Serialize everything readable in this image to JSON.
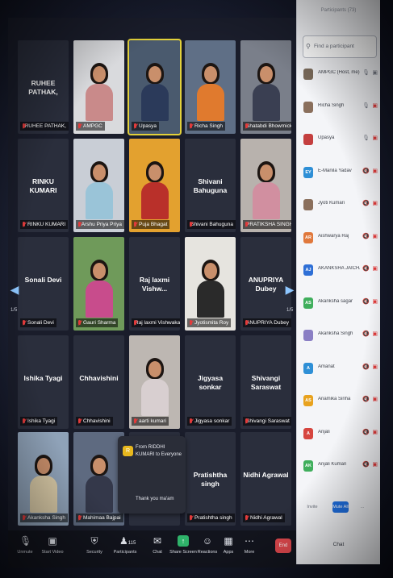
{
  "panel": {
    "title": "Participants (73)",
    "search_placeholder": "Find a participant",
    "participants": [
      {
        "name": "AMPGC (Host, me)",
        "initials": "",
        "color": "#7a6a5a",
        "mic": "on",
        "video": "on"
      },
      {
        "name": "Richa Singh",
        "initials": "",
        "color": "#8a6f5c",
        "mic": "on",
        "video": "off"
      },
      {
        "name": "Upasya",
        "initials": "",
        "color": "#c43f3f",
        "mic": "on",
        "video": "off"
      },
      {
        "name": "E-Manila Yadav",
        "initials": "EY",
        "color": "#2e8fd6",
        "mic": "off",
        "video": "off"
      },
      {
        "name": "Jyoti Kumari",
        "initials": "",
        "color": "#8a6f5c",
        "mic": "off",
        "video": "off"
      },
      {
        "name": "Aishwarya Raj",
        "initials": "AR",
        "color": "#e0783c",
        "mic": "off",
        "video": "off"
      },
      {
        "name": "AKANKSHA JAICHAND",
        "initials": "AJ",
        "color": "#2e6fd6",
        "mic": "off",
        "video": "off"
      },
      {
        "name": "Akanksha sagar",
        "initials": "AS",
        "color": "#3fae5c",
        "mic": "off",
        "video": "off"
      },
      {
        "name": "Akanksha Singh",
        "initials": "",
        "color": "#8a7fc4",
        "mic": "off",
        "video": "off"
      },
      {
        "name": "Amanat",
        "initials": "A",
        "color": "#2e8fd6",
        "mic": "off",
        "video": "off"
      },
      {
        "name": "Anamika Sinha",
        "initials": "AS",
        "color": "#e8a21e",
        "mic": "off",
        "video": "off"
      },
      {
        "name": "Anjali",
        "initials": "A",
        "color": "#d6453f",
        "mic": "off",
        "video": "off"
      },
      {
        "name": "Anjali Kumari",
        "initials": "AK",
        "color": "#3fae5c",
        "mic": "off",
        "video": "off"
      }
    ],
    "footer": {
      "invite_label": "Invite",
      "mute_all_label": "Mute All",
      "more_label": "...",
      "chat_label": "Chat"
    }
  },
  "grid": {
    "tiles": [
      {
        "label": "RUHEE PATHAK,",
        "big": "RUHEE PATHAK,",
        "video": false
      },
      {
        "label": "AMPGC",
        "big": "",
        "video": true,
        "shirt": "#c98a8a",
        "bg": "#d9dadd"
      },
      {
        "label": "Upasya",
        "big": "",
        "video": true,
        "active": true,
        "shirt": "#2b3a5a",
        "bg": "#4a5a6e"
      },
      {
        "label": "Richa Singh",
        "big": "",
        "video": true,
        "shirt": "#e07a2e",
        "bg": "#5f6f86"
      },
      {
        "label": "Shatabdi Bhowmick",
        "big": "",
        "video": true,
        "shirt": "#3a3f52",
        "bg": "#7a7f8a"
      },
      {
        "label": "RINKU KUMARI",
        "big": "RINKU KUMARI",
        "video": false
      },
      {
        "label": "Arshu Priya Priya",
        "big": "",
        "video": true,
        "shirt": "#9ac4d8",
        "bg": "#c9ced6"
      },
      {
        "label": "Puja Bhagat",
        "big": "",
        "video": true,
        "shirt": "#b9302a",
        "bg": "#e3a12f"
      },
      {
        "label": "Shivani Bahuguna",
        "big": "Shivani Bahuguna",
        "video": false
      },
      {
        "label": "PRATIKSHA SINGH",
        "big": "",
        "video": true,
        "shirt": "#d18fa0",
        "bg": "#b8b2ad"
      },
      {
        "label": "Sonali Devi",
        "big": "Sonali Devi",
        "video": false
      },
      {
        "label": "Gauri Sharma",
        "big": "",
        "video": true,
        "shirt": "#c84c8c",
        "bg": "#6f9a5a"
      },
      {
        "label": "Raj laxmi Vishwakarma",
        "big": "Raj laxmi Vishw...",
        "video": false
      },
      {
        "label": "Jyotismita Roy",
        "big": "",
        "video": true,
        "shirt": "#2a2a2a",
        "bg": "#e6e4df"
      },
      {
        "label": "ANUPRIYA Dubey",
        "big": "ANUPRIYA Dubey",
        "video": false
      },
      {
        "label": "Ishika Tyagi",
        "big": "Ishika Tyagi",
        "video": false
      },
      {
        "label": "Chhavishini",
        "big": "Chhavishini",
        "video": false
      },
      {
        "label": "aarti kumari",
        "big": "",
        "video": true,
        "shirt": "#d8cfd0",
        "bg": "#bdb7b2"
      },
      {
        "label": "Jigyasa sonkar",
        "big": "Jigyasa sonkar",
        "video": false
      },
      {
        "label": "Shivangi Saraswat",
        "big": "Shivangi Saraswat",
        "video": false
      },
      {
        "label": "Akanksha Singh",
        "big": "",
        "video": true,
        "shirt": "#d8c9a6",
        "bg": "#8fa2b8"
      },
      {
        "label": "Mahimaa Bajpai",
        "big": "",
        "video": true,
        "shirt": "#34384a",
        "bg": "#5e6a80"
      },
      {
        "label": "",
        "big": "",
        "video": false
      },
      {
        "label": "Pratishtha singh",
        "big": "Pratishtha singh",
        "video": false
      },
      {
        "label": "Nidhi Agrawal",
        "big": "Nidhi Agrawal",
        "video": false
      }
    ],
    "page_left": "1/5",
    "page_right": "1/5"
  },
  "chat_toast": {
    "initial": "R",
    "from": "From RIDDHI KUMARI to Everyone",
    "message": "Thank you ma'am"
  },
  "toolbar": {
    "unmute_label": "Unmute",
    "video_label": "Start Video",
    "security_label": "Security",
    "participants_label": "Participants",
    "participants_count": "115",
    "chat_label": "Chat",
    "share_label": "Share Screen",
    "reactions_label": "Reactions",
    "apps_label": "Apps",
    "more_label": "More",
    "end_label": "End"
  },
  "colors": {
    "accent": "#1f6fe0",
    "share": "#2fb36a",
    "end": "#e0484d",
    "active_speaker": "#e3d13a"
  }
}
